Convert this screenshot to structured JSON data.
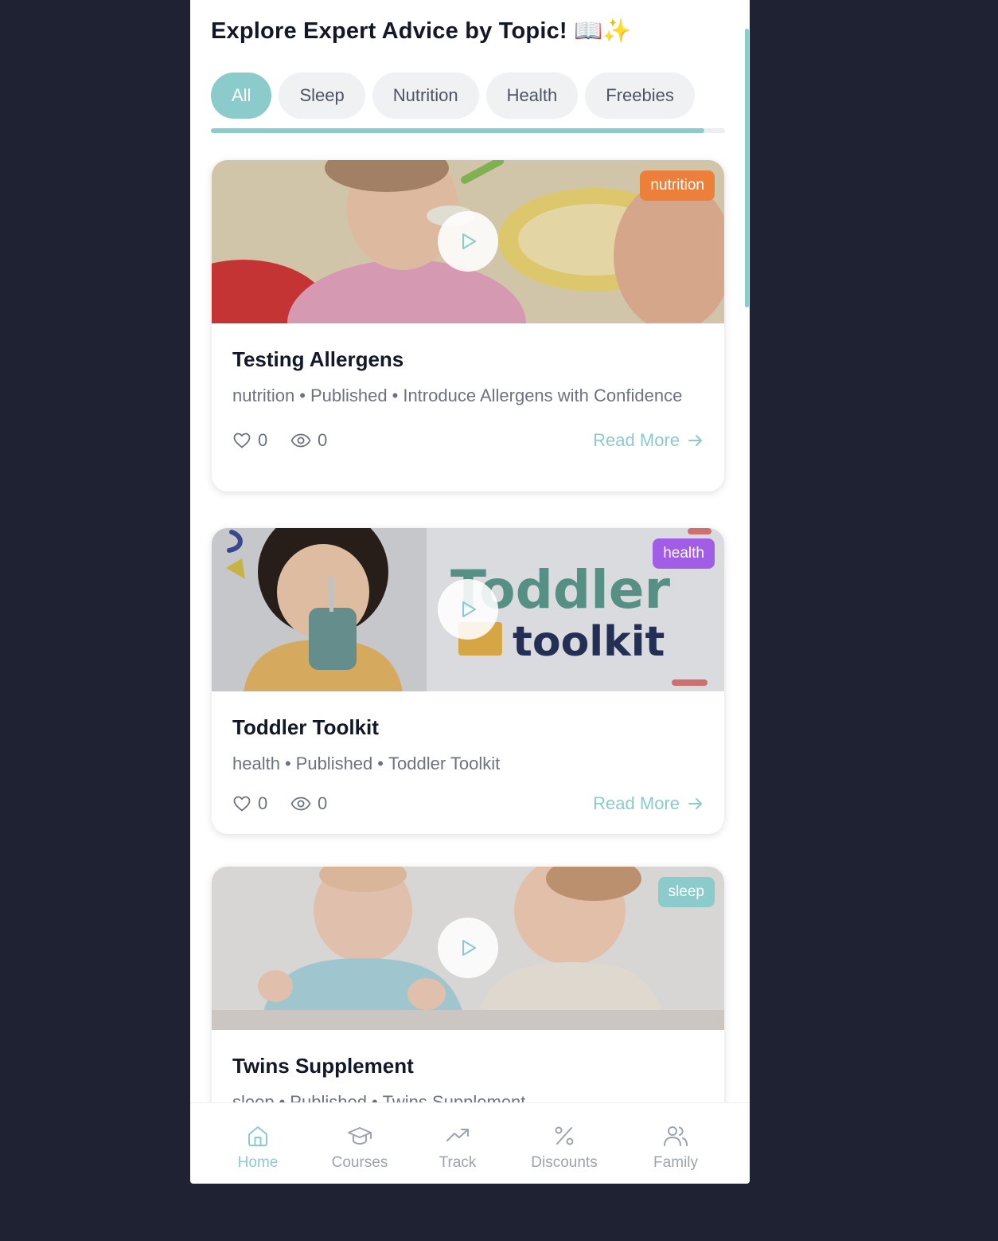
{
  "heading": "Explore Expert Advice by Topic! 📖✨",
  "filters": [
    "All",
    "Sleep",
    "Nutrition",
    "Health",
    "Freebies"
  ],
  "active_filter": "All",
  "posts": [
    {
      "title": "Testing Allergens",
      "category": "nutrition",
      "status": "Published",
      "series": "Introduce Allergens with Confidence",
      "badge": "nutrition",
      "badge_color": "#ec7f3a",
      "likes": "0",
      "views": "0",
      "read_more": "Read More"
    },
    {
      "title": "Toddler Toolkit",
      "category": "health",
      "status": "Published",
      "series": "Toddler Toolkit",
      "badge": "health",
      "badge_color": "#a25de6",
      "image_text_1": "Toddler",
      "image_text_2": "toolkit",
      "likes": "0",
      "views": "0",
      "read_more": "Read More"
    },
    {
      "title": "Twins Supplement",
      "category": "sleep",
      "status": "Published",
      "series": "Twins Supplement",
      "badge": "sleep",
      "badge_color": "#8ccbcb"
    }
  ],
  "separator": "•",
  "nav": [
    {
      "label": "Home",
      "icon": "home-icon",
      "active": true
    },
    {
      "label": "Courses",
      "icon": "graduation-cap-icon",
      "active": false
    },
    {
      "label": "Track",
      "icon": "trending-up-icon",
      "active": false
    },
    {
      "label": "Discounts",
      "icon": "percent-icon",
      "active": false
    },
    {
      "label": "Family",
      "icon": "users-icon",
      "active": false
    }
  ],
  "colors": {
    "accent": "#8ccbcb",
    "background": "#1e2233",
    "text_primary": "#111827",
    "text_secondary": "#6b7280"
  }
}
